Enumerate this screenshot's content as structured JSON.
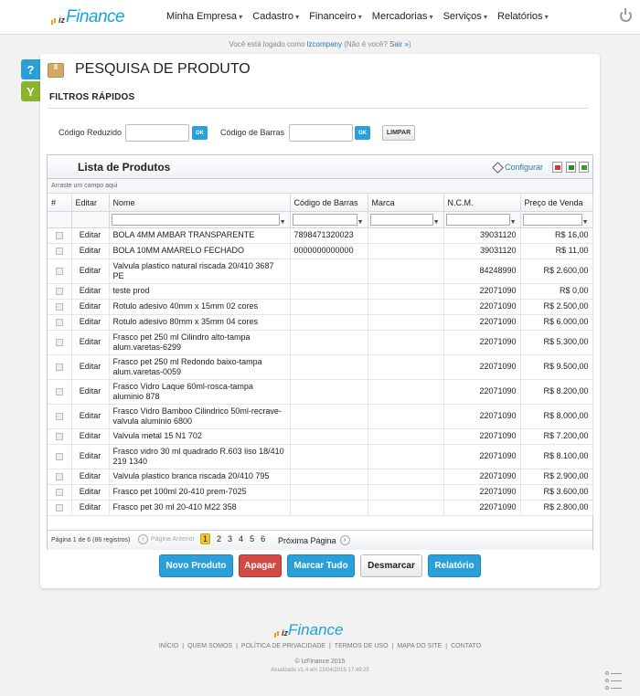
{
  "brand": {
    "prefix": "iz",
    "name": "Finance"
  },
  "nav": [
    "Minha Empresa",
    "Cadastro",
    "Financeiro",
    "Mercadorias",
    "Serviços",
    "Relatórios"
  ],
  "session": {
    "before": "Você está logado como ",
    "user": "lzcompany",
    "middle": " (Não é você? ",
    "logout": "Sair »",
    "after": ")"
  },
  "side": {
    "help": "?",
    "filter": "Y"
  },
  "page_title": "PESQUISA DE PRODUTO",
  "filters": {
    "title": "FILTROS RÁPIDOS",
    "codigo_reduzido": "Código Reduzido",
    "codigo_barras": "Código de Barras",
    "ok": "OK",
    "limpar": "LIMPAR"
  },
  "grid": {
    "title": "Lista de Produtos",
    "configurar": "Configurar",
    "group_hint": "Arraste um campo aqui",
    "columns": [
      "#",
      "Editar",
      "Nome",
      "Código de Barras",
      "Marca",
      "N.C.M.",
      "Preço de Venda"
    ],
    "filter_arrow": "▼",
    "edit_label": "Editar",
    "rows": [
      {
        "nome": "BOLA 4MM AMBAR TRANSPARENTE",
        "barras": "7898471320023",
        "marca": "",
        "ncm": "39031120",
        "preco": "R$ 16,00"
      },
      {
        "nome": "BOLA 10MM AMARELO FECHADO",
        "barras": "0000000000000",
        "marca": "",
        "ncm": "39031120",
        "preco": "R$ 11,00"
      },
      {
        "nome": "Valvula plastico natural riscada 20/410 3687 PE",
        "barras": "",
        "marca": "",
        "ncm": "84248990",
        "preco": "R$ 2.600,00"
      },
      {
        "nome": "teste prod",
        "barras": "",
        "marca": "",
        "ncm": "22071090",
        "preco": "R$ 0,00"
      },
      {
        "nome": "Rotulo adesivo 40mm x 15mm 02 cores",
        "barras": "",
        "marca": "",
        "ncm": "22071090",
        "preco": "R$ 2.500,00"
      },
      {
        "nome": "Rotulo adesivo 80mm x 35mm 04 cores",
        "barras": "",
        "marca": "",
        "ncm": "22071090",
        "preco": "R$ 6.000,00"
      },
      {
        "nome": "Frasco pet 250 ml Cilindro alto-tampa alum.varetas-6299",
        "barras": "",
        "marca": "",
        "ncm": "22071090",
        "preco": "R$ 5.300,00"
      },
      {
        "nome": "Frasco pet 250 ml Redondo baixo-tampa alum.varetas-0059",
        "barras": "",
        "marca": "",
        "ncm": "22071090",
        "preco": "R$ 9.500,00"
      },
      {
        "nome": "Frasco Vidro Laque 60ml-rosca-tampa aluminio 878",
        "barras": "",
        "marca": "",
        "ncm": "22071090",
        "preco": "R$ 8.200,00"
      },
      {
        "nome": "Frasco Vidro Bamboo Cilindrico 50ml-recrave-valvula aluminio 6800",
        "barras": "",
        "marca": "",
        "ncm": "22071090",
        "preco": "R$ 8.000,00"
      },
      {
        "nome": "Valvula metal 15 N1 702",
        "barras": "",
        "marca": "",
        "ncm": "22071090",
        "preco": "R$ 7.200,00"
      },
      {
        "nome": "Frasco vidro 30 ml quadrado R.603 liso 18/410 219 1340",
        "barras": "",
        "marca": "",
        "ncm": "22071090",
        "preco": "R$ 8.100,00"
      },
      {
        "nome": "Valvula plastico branca riscada 20/410 795",
        "barras": "",
        "marca": "",
        "ncm": "22071090",
        "preco": "R$ 2.900,00"
      },
      {
        "nome": "Frasco pet 100ml 20-410 prem-7025",
        "barras": "",
        "marca": "",
        "ncm": "22071090",
        "preco": "R$ 3.600,00"
      },
      {
        "nome": "Frasco pet 30 ml 20-410 M22 358",
        "barras": "",
        "marca": "",
        "ncm": "22071090",
        "preco": "R$ 2.800,00"
      }
    ]
  },
  "pager": {
    "info": "Página 1 de 6 (86 registros)",
    "prev": "Página Anterior",
    "pages": [
      "1",
      "2",
      "3",
      "4",
      "5",
      "6"
    ],
    "current": "1",
    "next": "Próxima Página",
    "prev_arrow": "‹",
    "next_arrow": "›"
  },
  "actions": {
    "novo": "Novo Produto",
    "apagar": "Apagar",
    "marcar": "Marcar Tudo",
    "desmarcar": "Desmarcar",
    "relatorio": "Relatório"
  },
  "footer": {
    "links": [
      "INÍCIO",
      "QUEM SOMOS",
      "POLÍTICA DE PRIVACIDADE",
      "TERMOS DE USO",
      "MAPA DO SITE",
      "CONTATO"
    ],
    "copyright": "© IzFinance 2015",
    "updated": "Atualizado v1.4 em 22/04/2015 17:49:25"
  },
  "colors": {
    "accent": "#2ba0d8",
    "danger": "#d14a44",
    "filter_tab": "#8bb42a",
    "current_page": "#f4c430"
  }
}
